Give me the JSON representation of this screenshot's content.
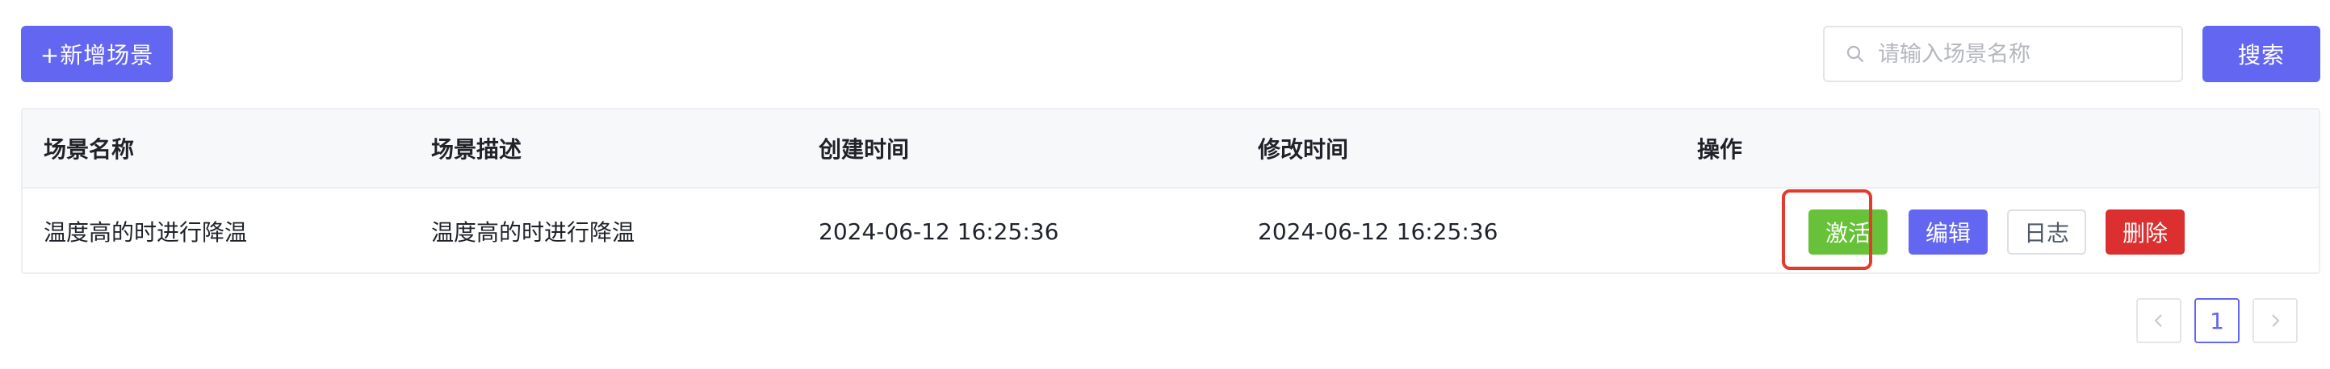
{
  "toolbar": {
    "add_label": "+新增场景",
    "search_placeholder": "请输入场景名称",
    "search_value": "",
    "search_button_label": "搜索"
  },
  "table": {
    "headers": [
      "场景名称",
      "场景描述",
      "创建时间",
      "修改时间",
      "操作"
    ],
    "rows": [
      {
        "name": "温度高的时进行降温",
        "description": "温度高的时进行降温",
        "created": "2024-06-12 16:25:36",
        "modified": "2024-06-12 16:25:36",
        "actions": {
          "activate": "激活",
          "edit": "编辑",
          "log": "日志",
          "delete": "删除"
        }
      }
    ]
  },
  "pagination": {
    "current_page": "1",
    "prev_icon": "chevron-left-icon",
    "next_icon": "chevron-right-icon"
  },
  "colors": {
    "primary": "#6366f1",
    "activate": "#67c23a",
    "delete": "#dc2f2f",
    "highlight": "#e23b2e"
  }
}
